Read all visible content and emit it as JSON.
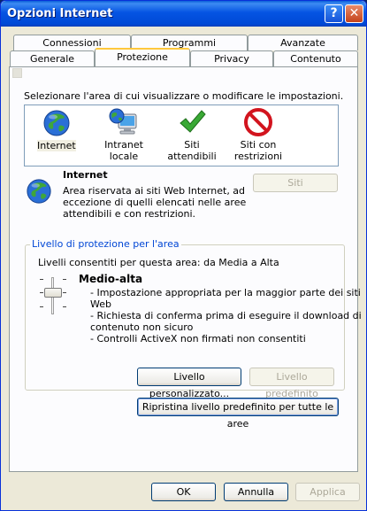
{
  "window": {
    "title": "Opzioni Internet"
  },
  "tabs": {
    "row1": [
      "Connessioni",
      "Programmi",
      "Avanzate"
    ],
    "row2": [
      "Generale",
      "Protezione",
      "Privacy",
      "Contenuto"
    ]
  },
  "zones": {
    "instruction": "Selezionare l'area di cui visualizzare o modificare le impostazioni.",
    "items": [
      {
        "label": "Internet",
        "icon": "globe-icon"
      },
      {
        "label": "Intranet locale",
        "icon": "computer-globe-icon"
      },
      {
        "label": "Siti attendibili",
        "icon": "check-icon"
      },
      {
        "label1": "Siti con",
        "label2": "restrizioni",
        "icon": "no-entry-icon"
      }
    ],
    "selected": "Internet"
  },
  "zone_info": {
    "title": "Internet",
    "desc1": "Area riservata ai siti Web Internet, ad",
    "desc2": "eccezione di quelli elencati nelle aree",
    "desc3": "attendibili e con restrizioni.",
    "sites_button": "Siti"
  },
  "security": {
    "group_label": "Livello di protezione per l'area",
    "allowed": "Livelli consentiti per questa area: da Media a Alta",
    "level_name": "Medio-alta",
    "bullets": [
      "- Impostazione appropriata per la maggior parte dei siti",
      "Web",
      "- Richiesta di conferma prima di eseguire il download di",
      "contenuto non sicuro",
      "- Controlli ActiveX non firmati non consentiti"
    ],
    "custom_button": "Livello personalizzato...",
    "default_button": "Livello predefinito",
    "reset_all_button": "Ripristina livello predefinito per tutte le aree"
  },
  "footer": {
    "ok": "OK",
    "cancel": "Annulla",
    "apply": "Applica"
  },
  "colors": {
    "titlebar": "#0554e3",
    "window": "#ece9d8",
    "group_label": "#0046d5"
  }
}
